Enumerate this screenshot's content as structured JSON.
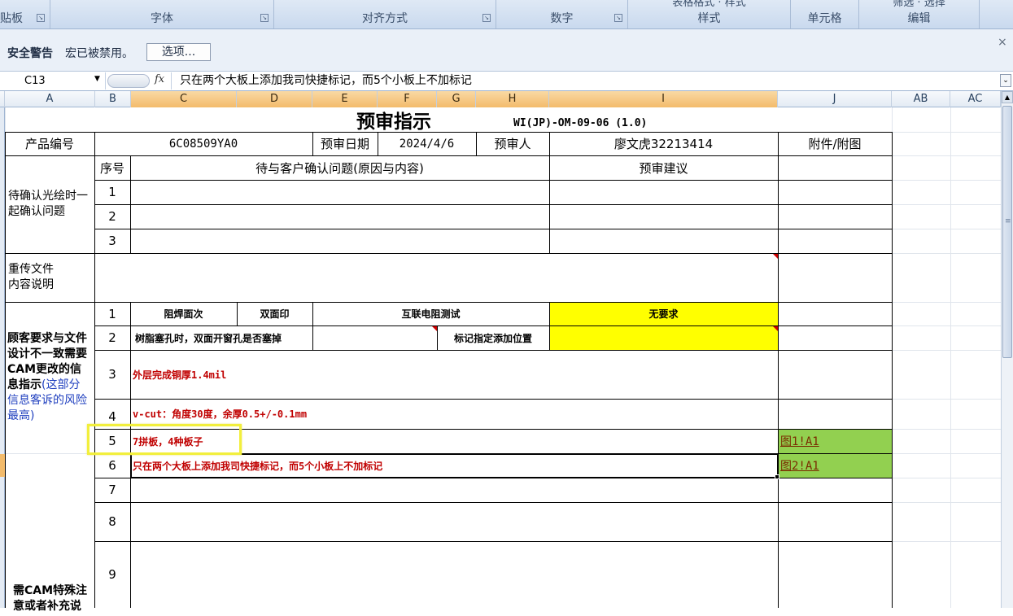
{
  "ribbon": {
    "groups": [
      {
        "label": "贴板"
      },
      {
        "label": "字体"
      },
      {
        "label": "对齐方式"
      },
      {
        "label": "数字"
      },
      {
        "label": "样式",
        "top_fragment": "表格格式 · 样式"
      },
      {
        "label": "单元格"
      },
      {
        "label": "编辑",
        "top_fragment": "筛选 · 选择"
      }
    ]
  },
  "security_bar": {
    "title": "安全警告",
    "message": "宏已被禁用。",
    "options_button": "选项...",
    "close": "×"
  },
  "formula_bar": {
    "name_box": "C13",
    "fx": "fx",
    "content": "只在两个大板上添加我司快捷标记，而5个小板上不加标记"
  },
  "columns": [
    "A",
    "B",
    "C",
    "D",
    "E",
    "F",
    "G",
    "H",
    "I",
    "J",
    "AB",
    "AC"
  ],
  "sheet": {
    "title": "预审指示",
    "doc_code": "WI(JP)-OM-09-06 (1.0)",
    "header_row": {
      "product_no_label": "产品编号",
      "product_no": "6C08509YA0",
      "review_date_label": "预审日期",
      "review_date": "2024/4/6",
      "reviewer_label": "预审人",
      "reviewer": "廖文虎32213414",
      "attachment_label": "附件/附图"
    },
    "confirm_section": {
      "label": "待确认光绘时一起确认问题",
      "seq_header": "序号",
      "question_header": "待与客户确认问题(原因与内容)",
      "suggest_header": "预审建议",
      "rows": [
        "1",
        "2",
        "3"
      ]
    },
    "reupload": {
      "label": "重传文件内容说明"
    },
    "customer_section": {
      "label_black": "顾客要求与文件设计不一致需要CAM更改的信息指示",
      "label_blue": "(这部分信息客诉的风险最高)",
      "row1": {
        "seq": "1",
        "c1": "阻焊面次",
        "c2": "双面印",
        "c3": "互联电阻测试",
        "c4": "无要求"
      },
      "row2": {
        "seq": "2",
        "c1": "树脂塞孔时，双面开窗孔是否塞掉",
        "c3": "标记指定添加位置"
      },
      "row3": {
        "seq": "3",
        "text": "外层完成铜厚1.4mil"
      },
      "row4": {
        "seq": "4",
        "text": "v-cut：角度30度，余厚0.5+/-0.1mm"
      },
      "row5": {
        "seq": "5",
        "text": "7拼板，4种板子",
        "attachment": "图1!A1"
      },
      "row6": {
        "seq": "6",
        "text": "只在两个大板上添加我司快捷标记，而5个小板上不加标记",
        "attachment": "图2!A1"
      }
    },
    "cam_section": {
      "label": "需CAM特殊注意或者补充说",
      "rows": [
        "7",
        "8",
        "9"
      ]
    }
  },
  "colors": {
    "yellow_fill": "#ffff00",
    "green_fill": "#92d050",
    "red_text": "#c00000",
    "selected_header": "#f3bb6b",
    "highlight_box": "#f2ef3c"
  }
}
